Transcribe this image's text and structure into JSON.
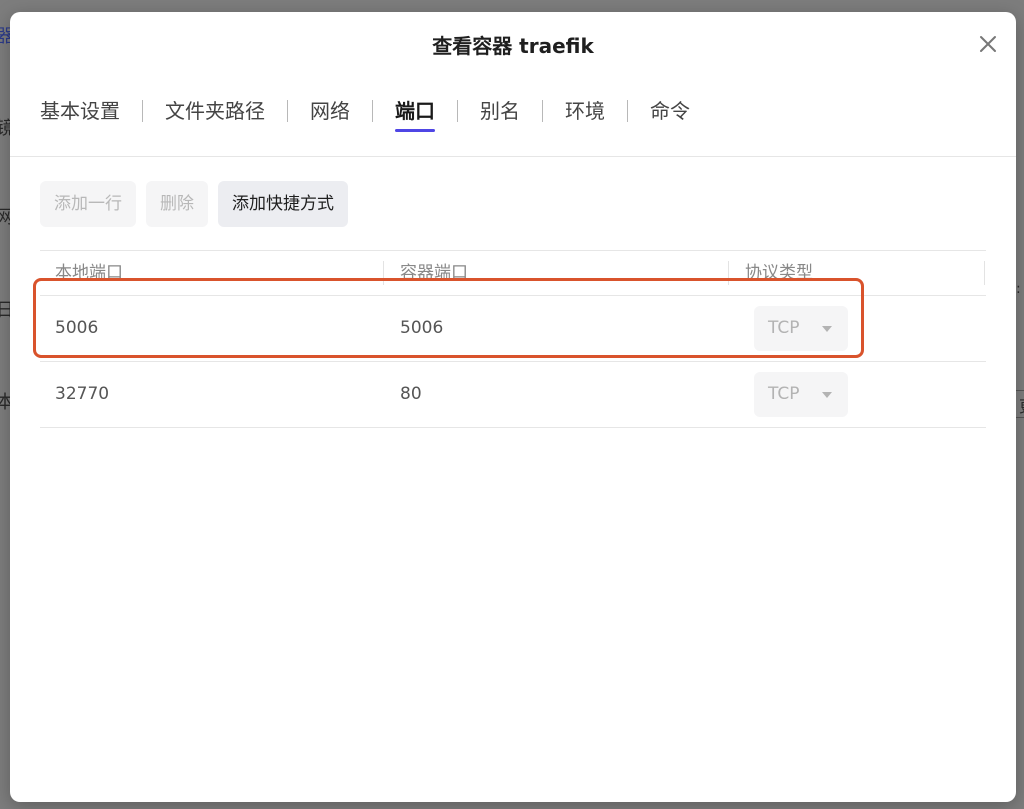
{
  "background": {
    "fragments": [
      "器",
      "镜",
      "网",
      "日",
      "本",
      ":",
      "更"
    ]
  },
  "dialog": {
    "title": "查看容器 traefik",
    "close_icon": "close-icon"
  },
  "tabs": [
    {
      "label": "基本设置",
      "active": false
    },
    {
      "label": "文件夹路径",
      "active": false
    },
    {
      "label": "网络",
      "active": false
    },
    {
      "label": "端口",
      "active": true
    },
    {
      "label": "别名",
      "active": false
    },
    {
      "label": "环境",
      "active": false
    },
    {
      "label": "命令",
      "active": false
    }
  ],
  "toolbar": {
    "add_row_label": "添加一行",
    "delete_label": "删除",
    "add_shortcut_label": "添加快捷方式"
  },
  "table": {
    "headers": [
      "本地端口",
      "容器端口",
      "协议类型"
    ],
    "rows": [
      {
        "local_port": "5006",
        "container_port": "5006",
        "protocol": "TCP"
      },
      {
        "local_port": "32770",
        "container_port": "80",
        "protocol": "TCP"
      }
    ]
  },
  "colors": {
    "accent": "#4f46e5",
    "highlight": "#d9532c"
  }
}
